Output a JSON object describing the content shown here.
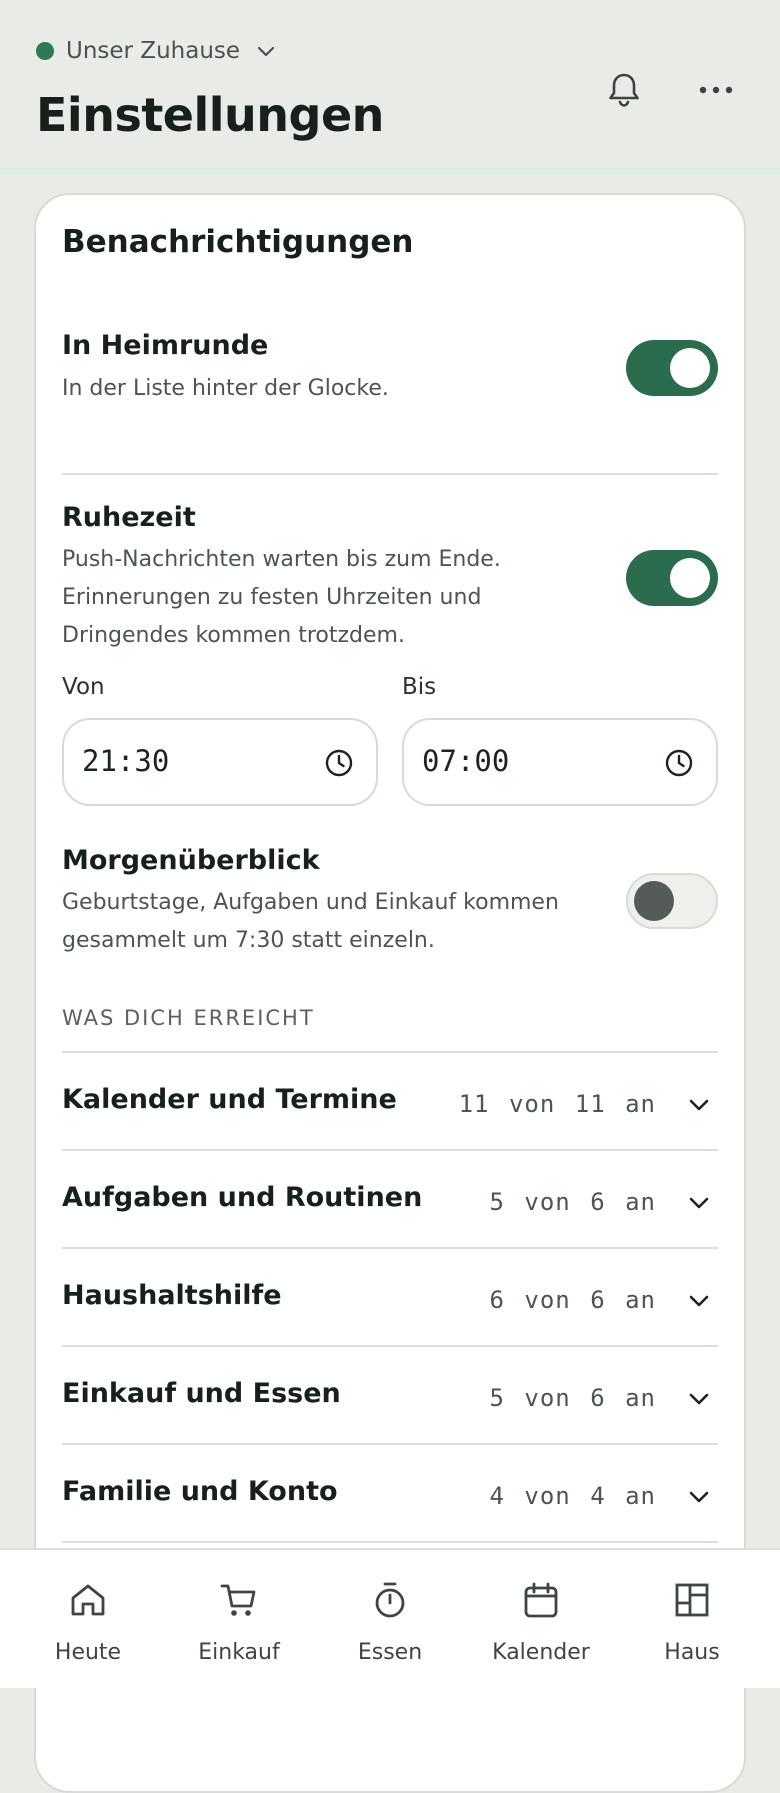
{
  "header": {
    "household_name": "Unser Zuhause",
    "household_status_color": "#2e7a57",
    "title": "Einstellungen",
    "icons": [
      "bell-icon",
      "more-icon"
    ]
  },
  "notifications": {
    "section_title": "Benachrichtigungen",
    "in_app": {
      "title": "In Heimrunde",
      "description": "In der Liste hinter der Glocke.",
      "enabled": true
    },
    "quiet_time": {
      "title": "Ruhezeit",
      "description": "Push-Nachrichten warten bis zum Ende. Erinnerungen zu festen Uhrzeiten und Dringendes kommen trotzdem.",
      "enabled": true,
      "from_label": "Von",
      "from_value": "21:30",
      "to_label": "Bis",
      "to_value": "07:00"
    },
    "morning_digest": {
      "title": "Morgenüberblick",
      "description": "Geburtstage, Aufgaben und Einkauf kommen gesammelt um 7:30 statt einzeln.",
      "enabled": false
    },
    "reach_heading": "WAS DICH ERREICHT",
    "categories": [
      {
        "title": "Kalender und Termine",
        "count": "11 von 11 an"
      },
      {
        "title": "Aufgaben und Routinen",
        "count": "5 von 6 an"
      },
      {
        "title": "Haushaltshilfe",
        "count": "6 von 6 an"
      },
      {
        "title": "Einkauf und Essen",
        "count": "5 von 6 an"
      },
      {
        "title": "Familie und Konto",
        "count": "4 von 4 an"
      }
    ]
  },
  "bottom_nav": [
    {
      "label": "Heute",
      "icon": "home-icon"
    },
    {
      "label": "Einkauf",
      "icon": "cart-icon"
    },
    {
      "label": "Essen",
      "icon": "timer-icon"
    },
    {
      "label": "Kalender",
      "icon": "calendar-icon"
    },
    {
      "label": "Haus",
      "icon": "house-layout-icon"
    }
  ],
  "colors": {
    "accent": "#2b6b4e",
    "background": "#e8ebe6",
    "card": "#ffffff"
  }
}
